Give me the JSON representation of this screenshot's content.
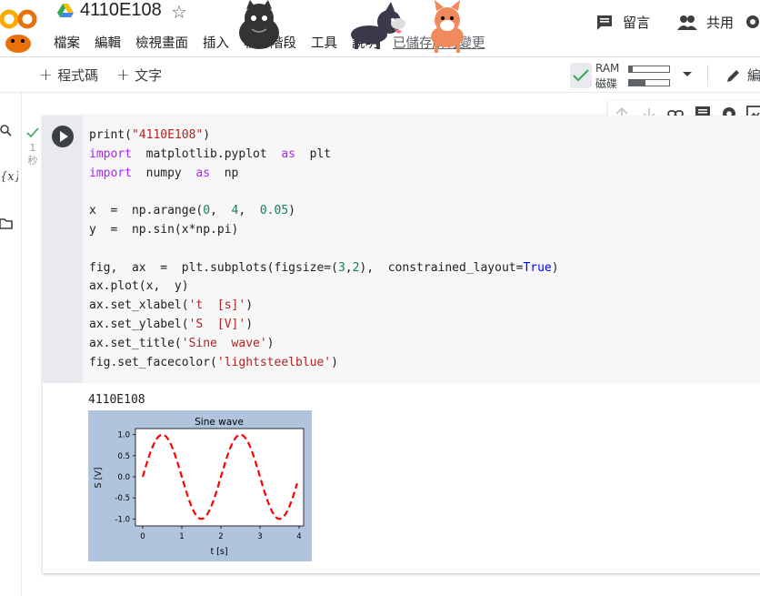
{
  "header": {
    "title": "4110E108",
    "menu": [
      "檔案",
      "編輯",
      "檢視畫面",
      "插入",
      "執行階段",
      "工具",
      "說明"
    ],
    "saved_status": "已儲存所有變更",
    "comment_label": "留言",
    "share_label": "共用"
  },
  "toolbar": {
    "add_code_label": "程式碼",
    "add_text_label": "文字",
    "ram_label": "RAM",
    "disk_label": "磁碟",
    "ram_usage": 0.1,
    "disk_usage": 0.4,
    "edit_label": "編"
  },
  "cell": {
    "status_time": "1",
    "status_unit": "秒",
    "output_text": "4110E108"
  },
  "chart_data": {
    "type": "line",
    "title": "Sine wave",
    "xlabel": "t [s]",
    "ylabel": "S [V]",
    "xlim": [
      0,
      4
    ],
    "ylim": [
      -1.1,
      1.1
    ],
    "x_ticks": [
      "0",
      "1",
      "2",
      "3",
      "4"
    ],
    "y_ticks": [
      "1.0",
      "0.5",
      "0.0",
      "-0.5",
      "-1.0"
    ],
    "x_tick_values": [
      0,
      1,
      2,
      3,
      4
    ],
    "y_tick_values": [
      1.0,
      0.5,
      0.0,
      -0.5,
      -1.0
    ],
    "function": "sin(pi*x)",
    "x_start": 0,
    "x_stop": 4,
    "x_step": 0.05,
    "line_color": "#ff0000",
    "line_style": "dashed",
    "face_color": "#b0c4de"
  },
  "colors": {
    "accent_green": "#34a853",
    "code_bg": "#f7f7f7"
  }
}
